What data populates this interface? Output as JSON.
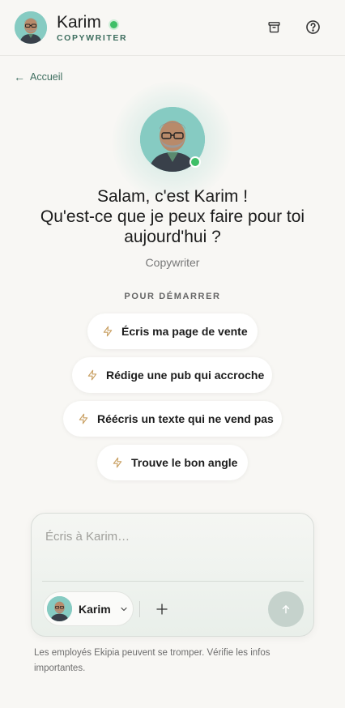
{
  "header": {
    "name": "Karim",
    "role": "COPYWRITER",
    "archive_icon": "archive-box-icon",
    "help_icon": "question-circle-icon",
    "online_color": "#3fbf68"
  },
  "nav": {
    "back_label": "Accueil",
    "back_icon": "arrow-left-icon"
  },
  "hero": {
    "greeting_line1": "Salam, c'est Karim !",
    "greeting_line2": "Qu'est-ce que je peux faire pour toi",
    "greeting_line3": "aujourd'hui ?",
    "subtitle": "Copywriter"
  },
  "suggestions": {
    "section_label": "POUR DÉMARRER",
    "icon": "lightning-bolt-icon",
    "items": [
      {
        "label": "Écris ma page de vente"
      },
      {
        "label": "Rédige une pub qui accroche"
      },
      {
        "label": "Réécris un texte qui ne vend pas"
      },
      {
        "label": "Trouve le bon angle"
      }
    ]
  },
  "composer": {
    "placeholder": "Écris à Karim…",
    "agent_label": "Karim",
    "add_icon": "plus-icon",
    "send_icon": "arrow-up-icon"
  },
  "footer": {
    "disclaimer": "Les employés Ekipia peuvent se tromper. Vérifie les infos importantes."
  },
  "colors": {
    "accent": "#3e6e5f",
    "background": "#f8f7f4",
    "bolt": "#c9a063"
  }
}
